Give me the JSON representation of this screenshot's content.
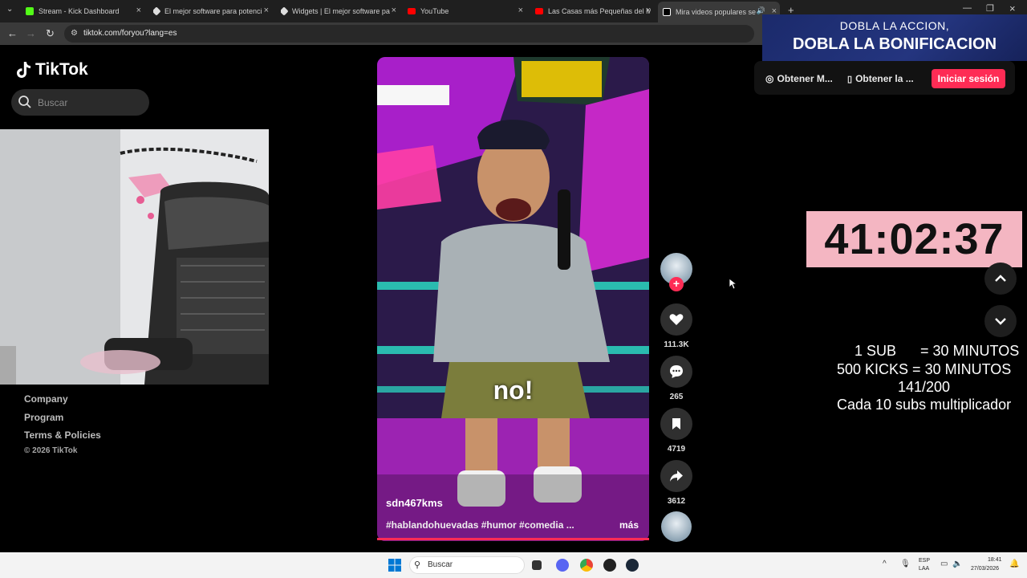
{
  "browser": {
    "tabs": [
      {
        "title": "Stream - Kick Dashboard",
        "color": "#53fc18"
      },
      {
        "title": "El mejor software para potenci",
        "color": "#ffffff"
      },
      {
        "title": "Widgets | El mejor software pa",
        "color": "#ffffff"
      },
      {
        "title": "YouTube",
        "color": "#ff0000"
      },
      {
        "title": "Las Casas más Pequeñas del M",
        "color": "#ff0000"
      },
      {
        "title": "Mira videos populares selec",
        "color": "#ffffff",
        "active": true
      }
    ],
    "url": "tiktok.com/foryou?lang=es"
  },
  "promo": {
    "line1": "DOBLA LA ACCION,",
    "line2": "DOBLA LA BONIFICACION"
  },
  "tiktok": {
    "logo": "TikTok",
    "search_placeholder": "Buscar",
    "header": {
      "get_app1": "Obtener M...",
      "get_app2": "Obtener la ...",
      "login": "Iniciar sesión"
    },
    "footer": {
      "links": [
        "Company",
        "Program",
        "Terms & Policies"
      ],
      "copyright": "© 2026 TikTok"
    },
    "video": {
      "caption": "no!",
      "author": "sdn467kms",
      "tags": "#hablandohuevadas #humor #comedia ...",
      "more": "más",
      "progress": 1.0
    },
    "actions": {
      "likes": "111.3K",
      "comments": "265",
      "saves": "4719",
      "shares": "3612"
    }
  },
  "overlay": {
    "timer": "41:02:37",
    "rules": [
      "1 SUB      = 30 MINUTOS",
      "500 KICKS = 30 MINUTOS",
      "141/200",
      "Cada 10 subs multiplicador"
    ]
  },
  "taskbar": {
    "search": "Buscar",
    "lang1": "ESP",
    "lang2": "LAA",
    "time": "18:41",
    "date": "27/03/2026"
  }
}
